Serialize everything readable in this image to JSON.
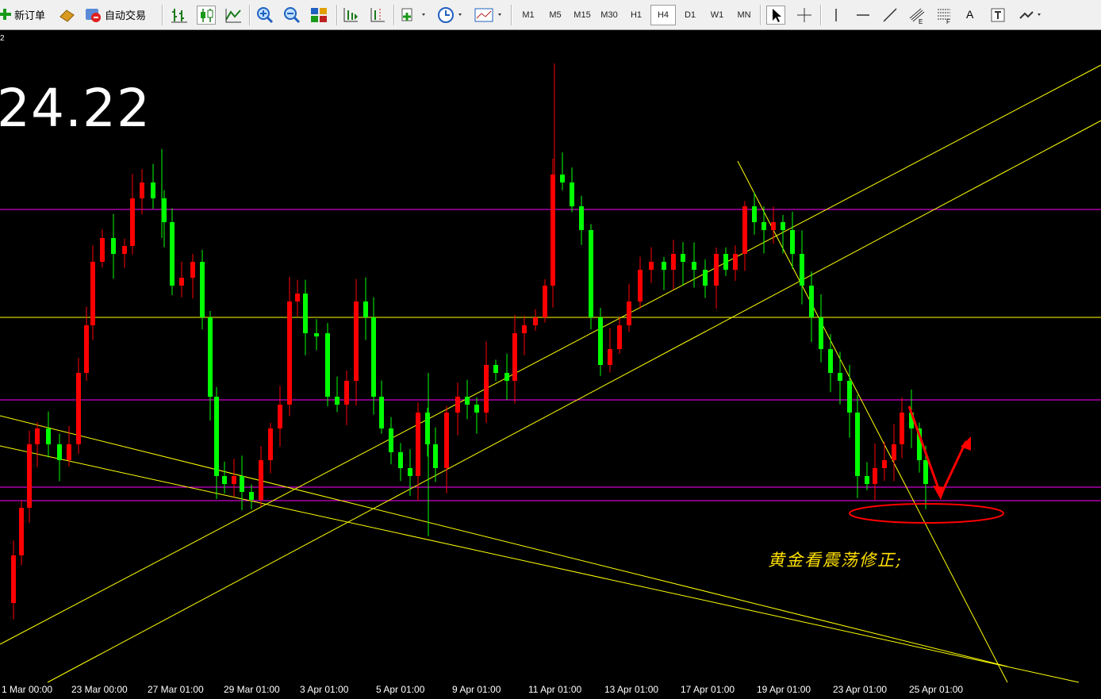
{
  "toolbar": {
    "new_order": "新订单",
    "auto_trading": "自动交易",
    "timeframes": [
      "M1",
      "M5",
      "M15",
      "M30",
      "H1",
      "H4",
      "D1",
      "W1",
      "MN"
    ],
    "active_timeframe": "H4",
    "text_tool": "A"
  },
  "chart": {
    "corner_label": "2",
    "big_price": "24.22",
    "annotation": "黄金看震荡修正;",
    "x_labels": [
      "1 Mar 00:00",
      "23 Mar 00:00",
      "27 Mar 01:00",
      "29 Mar 01:00",
      "3 Apr 01:00",
      "5 Apr 01:00",
      "9 Apr 01:00",
      "11 Apr 01:00",
      "13 Apr 01:00",
      "17 Apr 01:00",
      "19 Apr 01:00",
      "23 Apr 01:00",
      "25 Apr 01:00"
    ],
    "colors": {
      "background": "#000000",
      "bull_candle": "#ff0000",
      "bear_candle": "#00ff00",
      "trendline": "#ffff00",
      "horizontal_magenta": "#ff00ff",
      "horizontal_yellow": "#ffff00",
      "drawing_red": "#ff0000"
    }
  }
}
